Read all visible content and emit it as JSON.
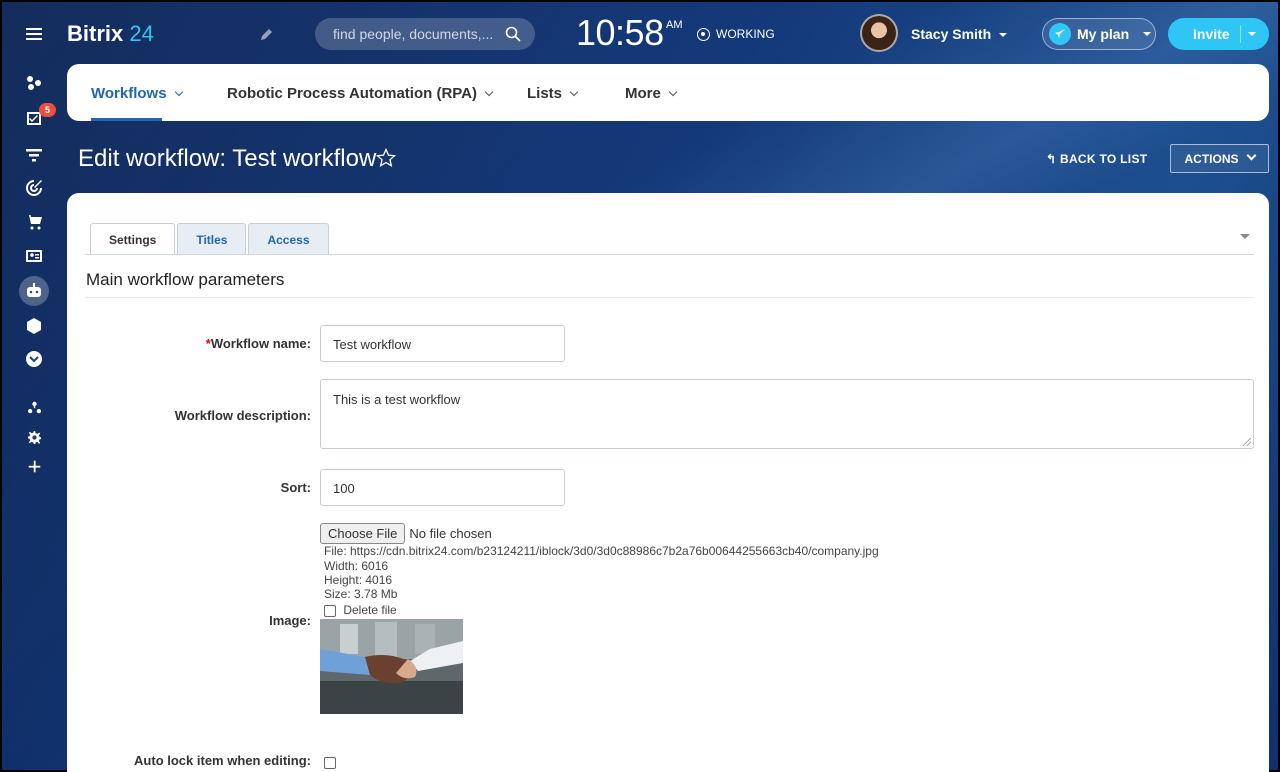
{
  "app": {
    "logo_main": "Bitrix",
    "logo_num": "24"
  },
  "rail": {
    "tasks_badge": "5"
  },
  "header": {
    "search_placeholder": "find people, documents,...",
    "time": "10:58",
    "ampm": "AM",
    "status": "WORKING",
    "user_name": "Stacy Smith",
    "plan_label": "My plan",
    "invite_label": "Invite"
  },
  "nav": {
    "items": [
      {
        "label": "Workflows"
      },
      {
        "label": "Robotic Process Automation (RPA)"
      },
      {
        "label": "Lists"
      },
      {
        "label": "More"
      }
    ]
  },
  "page": {
    "title": "Edit workflow: Test workflow",
    "back_label": "BACK TO LIST",
    "actions_label": "ACTIONS"
  },
  "tabs": [
    {
      "label": "Settings"
    },
    {
      "label": "Titles"
    },
    {
      "label": "Access"
    }
  ],
  "section": {
    "title": "Main workflow parameters"
  },
  "form": {
    "name_label_req": "*",
    "name_label": "Workflow name:",
    "name_value": "Test workflow",
    "desc_label": "Workflow description:",
    "desc_value": "This is a test workflow",
    "sort_label": "Sort:",
    "sort_value": "100",
    "image_label": "Image:",
    "choose_file": "Choose File",
    "no_file": "No file chosen",
    "file_path": "File: https://cdn.bitrix24.com/b23124211/iblock/3d0/3d0c88986c7b2a76b00644255663cb40/company.jpg",
    "width": "Width: 6016",
    "height": "Height: 4016",
    "size": "Size: 3.78 Mb",
    "delete_file": "Delete file",
    "autolock_label": "Auto lock item when editing:"
  }
}
